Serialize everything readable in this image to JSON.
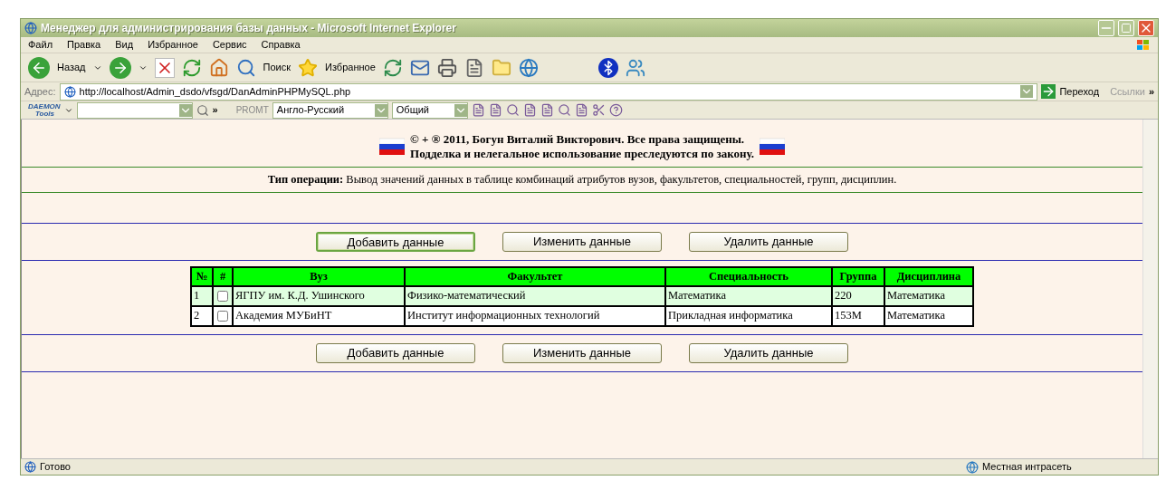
{
  "window": {
    "title": "Менеджер для администрирования базы данных - Microsoft Internet Explorer"
  },
  "menu": [
    "Файл",
    "Правка",
    "Вид",
    "Избранное",
    "Сервис",
    "Справка"
  ],
  "toolbar": {
    "back": "Назад",
    "search": "Поиск",
    "favorites": "Избранное"
  },
  "address": {
    "label": "Адрес:",
    "value": "http://localhost/Admin_dsdo/vfsgd/DanAdminPHPMySQL.php",
    "go": "Переход",
    "links": "Ссылки",
    "more": "»"
  },
  "daemon_toolbar": {
    "logo_top": "DAEMON",
    "logo_bottom": "Tools",
    "more": "»",
    "promt": "PROMT",
    "language": "Англо-Русский",
    "topic": "Общий"
  },
  "page": {
    "copyright_lines": [
      "© + ® 2011, Богун Виталий Викторович. Все права защищены.",
      "Подделка и нелегальное использование преследуются по закону."
    ],
    "operation": "**Тип операции:** Вывод значений данных в таблице комбинаций атрибутов вузов, факультетов, специальностей, групп, дисциплин.",
    "top_buttons": [
      {
        "label": "Добавить данные",
        "focused": true
      },
      {
        "label": "Изменить данные",
        "focused": false
      },
      {
        "label": "Удалить данные",
        "focused": false
      }
    ],
    "table": {
      "columns": [
        "№",
        "#",
        "Вуз",
        "Факультет",
        "Специальность",
        "Группа",
        "Дисциплина"
      ],
      "rows": [
        {
          "number": "1",
          "checked": false,
          "shaded": true,
          "university": "ЯГПУ им. К.Д. Ушинского",
          "faculty": "Физико-математический",
          "specialty": "Математика",
          "group": "220",
          "discipline": "Математика"
        },
        {
          "number": "2",
          "checked": false,
          "shaded": false,
          "university": "Академия МУБиНТ",
          "faculty": "Институт информационных технологий",
          "specialty": "Прикладная информатика",
          "group": "153М",
          "discipline": "Математика"
        }
      ]
    },
    "bottom_buttons": [
      {
        "label": "Добавить данные",
        "focused": false
      },
      {
        "label": "Изменить данные",
        "focused": false
      },
      {
        "label": "Удалить данные",
        "focused": false
      }
    ]
  },
  "status_bar": {
    "text": "Готово",
    "zone": "Местная интрасеть"
  }
}
